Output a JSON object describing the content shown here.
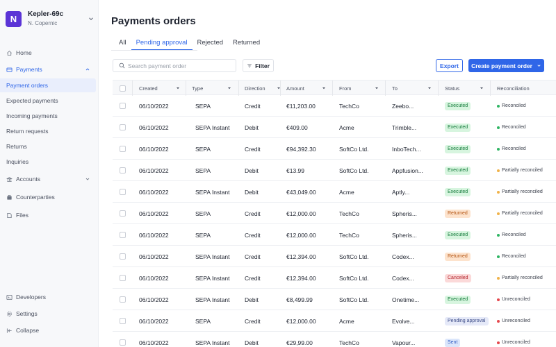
{
  "org": {
    "logo_letter": "N",
    "name": "Kepler-69c",
    "user": "N. Copernic"
  },
  "sidebar": {
    "home": "Home",
    "payments": "Payments",
    "sub_items": [
      {
        "label": "Payment orders",
        "active": true
      },
      {
        "label": "Expected payments",
        "active": false
      },
      {
        "label": "Incoming payments",
        "active": false
      },
      {
        "label": "Return requests",
        "active": false
      },
      {
        "label": "Returns",
        "active": false
      },
      {
        "label": "Inquiries",
        "active": false
      }
    ],
    "accounts": "Accounts",
    "counterparties": "Counterparties",
    "files": "Files",
    "developers": "Developers",
    "settings": "Settings",
    "collapse": "Collapse"
  },
  "main": {
    "title": "Payments orders",
    "tabs": [
      {
        "label": "All",
        "active": false
      },
      {
        "label": "Pending approval",
        "active": true
      },
      {
        "label": "Rejected",
        "active": false
      },
      {
        "label": "Returned",
        "active": false
      }
    ],
    "search_placeholder": "Search payment order",
    "filter_label": "Filter",
    "export_label": "Export",
    "create_label": "Create payment order"
  },
  "table": {
    "columns": [
      "Created",
      "Type",
      "Direction",
      "Amount",
      "From",
      "To",
      "Status",
      "Reconciliation"
    ],
    "rows": [
      {
        "created": "06/10/2022",
        "type": "SEPA",
        "direction": "Credit",
        "amount": "€11,203.00",
        "from": "TechCo",
        "to": "Zeebo...",
        "status": "Executed",
        "status_kind": "executed",
        "recon": "Reconciled",
        "recon_kind": "reconciled"
      },
      {
        "created": "06/10/2022",
        "type": "SEPA Instant",
        "direction": "Debit",
        "amount": "€409.00",
        "from": "Acme",
        "to": "Trimble...",
        "status": "Executed",
        "status_kind": "executed",
        "recon": "Reconciled",
        "recon_kind": "reconciled"
      },
      {
        "created": "06/10/2022",
        "type": "SEPA",
        "direction": "Credit",
        "amount": "€94,392.30",
        "from": "SoftCo Ltd.",
        "to": "InboTech...",
        "status": "Executed",
        "status_kind": "executed",
        "recon": "Reconciled",
        "recon_kind": "reconciled"
      },
      {
        "created": "06/10/2022",
        "type": "SEPA",
        "direction": "Debit",
        "amount": "€13.99",
        "from": "SoftCo Ltd.",
        "to": "Appfusion...",
        "status": "Executed",
        "status_kind": "executed",
        "recon": "Partially reconciled",
        "recon_kind": "partial"
      },
      {
        "created": "06/10/2022",
        "type": "SEPA Instant",
        "direction": "Debit",
        "amount": "€43,049.00",
        "from": "Acme",
        "to": "Aptly...",
        "status": "Executed",
        "status_kind": "executed",
        "recon": "Partially reconciled",
        "recon_kind": "partial"
      },
      {
        "created": "06/10/2022",
        "type": "SEPA",
        "direction": "Credit",
        "amount": "€12,000.00",
        "from": "TechCo",
        "to": "Spheris...",
        "status": "Returned",
        "status_kind": "returned",
        "recon": "Partially reconciled",
        "recon_kind": "partial"
      },
      {
        "created": "06/10/2022",
        "type": "SEPA",
        "direction": "Credit",
        "amount": "€12,000.00",
        "from": "TechCo",
        "to": "Spheris...",
        "status": "Executed",
        "status_kind": "executed",
        "recon": "Reconciled",
        "recon_kind": "reconciled"
      },
      {
        "created": "06/10/2022",
        "type": "SEPA Instant",
        "direction": "Credit",
        "amount": "€12,394.00",
        "from": "SoftCo Ltd.",
        "to": "Codex...",
        "status": "Returned",
        "status_kind": "returned",
        "recon": "Reconciled",
        "recon_kind": "reconciled"
      },
      {
        "created": "06/10/2022",
        "type": "SEPA Instant",
        "direction": "Credit",
        "amount": "€12,394.00",
        "from": "SoftCo Ltd.",
        "to": "Codex...",
        "status": "Canceled",
        "status_kind": "canceled",
        "recon": "Partially reconciled",
        "recon_kind": "partial"
      },
      {
        "created": "06/10/2022",
        "type": "SEPA Instant",
        "direction": "Debit",
        "amount": "€8,499.99",
        "from": "SoftCo Ltd.",
        "to": "Onetime...",
        "status": "Executed",
        "status_kind": "executed",
        "recon": "Unreconciled",
        "recon_kind": "unreconciled"
      },
      {
        "created": "06/10/2022",
        "type": "SEPA",
        "direction": "Credit",
        "amount": "€12,000.00",
        "from": "Acme",
        "to": "Evolve...",
        "status": "Pending approval",
        "status_kind": "pending",
        "recon": "Unreconciled",
        "recon_kind": "unreconciled"
      },
      {
        "created": "06/10/2022",
        "type": "SEPA Instant",
        "direction": "Debit",
        "amount": "€29,99.00",
        "from": "TechCo",
        "to": "Vapour...",
        "status": "Sent",
        "status_kind": "sent",
        "recon": "Unreconciled",
        "recon_kind": "unreconciled"
      }
    ]
  }
}
